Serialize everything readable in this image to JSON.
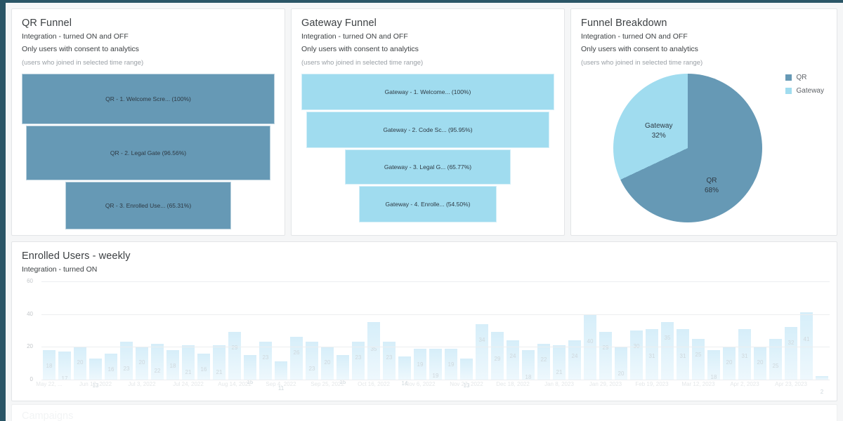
{
  "theme": {
    "qr_color": "#6699b5",
    "gateway_color": "#a0dcef",
    "bar_color": "#d6eef9",
    "page_border": "#2a5566"
  },
  "panels": {
    "qr_funnel": {
      "title": "QR Funnel",
      "subtitle_1": "Integration - turned ON and OFF",
      "subtitle_2": "Only users with consent to analytics",
      "note": "(users who joined in selected time range)"
    },
    "gateway_funnel": {
      "title": "Gateway Funnel",
      "subtitle_1": "Integration - turned ON and OFF",
      "subtitle_2": "Only users with consent to analytics",
      "note": "(users who joined in selected time range)"
    },
    "funnel_breakdown": {
      "title": "Funnel Breakdown",
      "subtitle_1": "Integration - turned ON and OFF",
      "subtitle_2": "Only users with consent to analytics",
      "note": "(users who joined in selected time range)"
    },
    "enrolled_users": {
      "title": "Enrolled Users - weekly",
      "subtitle_1": "Integration - turned ON"
    },
    "campaigns": {
      "title": "Campaigns"
    }
  },
  "chart_data": [
    {
      "type": "bar",
      "title": "QR Funnel",
      "orientation": "funnel",
      "categories": [
        "QR - 1. Welcome Scre...",
        "QR - 2. Legal Gate",
        "QR - 3. Enrolled Use..."
      ],
      "labels": [
        "QR - 1. Welcome Scre... (100%)",
        "QR - 2. Legal Gate (96.56%)",
        "QR - 3. Enrolled Use... (65.31%)"
      ],
      "values": [
        100,
        96.56,
        65.31
      ],
      "ylabel": "",
      "xlabel": "",
      "color": "#6699b5"
    },
    {
      "type": "bar",
      "title": "Gateway Funnel",
      "orientation": "funnel",
      "categories": [
        "Gateway - 1. Welcome...",
        "Gateway - 2. Code Sc...",
        "Gateway - 3. Legal G...",
        "Gateway - 4. Enrolle..."
      ],
      "labels": [
        "Gateway - 1. Welcome... (100%)",
        "Gateway - 2. Code Sc... (95.95%)",
        "Gateway - 3. Legal G... (65.77%)",
        "Gateway - 4. Enrolle... (54.50%)"
      ],
      "values": [
        100,
        95.95,
        65.77,
        54.5
      ],
      "ylabel": "",
      "xlabel": "",
      "color": "#a0dcef"
    },
    {
      "type": "pie",
      "title": "Funnel Breakdown",
      "categories": [
        "QR",
        "Gateway"
      ],
      "values": [
        68,
        32
      ],
      "slice_labels": [
        "QR\n68%",
        "Gateway\n32%"
      ],
      "colors": [
        "#6699b5",
        "#a0dcef"
      ],
      "legend": [
        "QR",
        "Gateway"
      ],
      "legend_position": "right"
    },
    {
      "type": "bar",
      "title": "Enrolled Users - weekly",
      "xlabel": "",
      "ylabel": "",
      "ylim": [
        0,
        60
      ],
      "yticks": [
        0,
        20,
        40,
        60
      ],
      "grid": true,
      "values": [
        18,
        17,
        20,
        13,
        16,
        23,
        20,
        22,
        18,
        21,
        16,
        21,
        29,
        15,
        23,
        11,
        26,
        23,
        20,
        15,
        23,
        35,
        23,
        14,
        19,
        19,
        19,
        13,
        34,
        29,
        24,
        18,
        22,
        21,
        24,
        40,
        29,
        20,
        30,
        31,
        35,
        31,
        25,
        18,
        20,
        31,
        20,
        25,
        32,
        41,
        2
      ],
      "xtick_labels": [
        "May 22, ...",
        "Jun 12, 2022",
        "Jul 3, 2022",
        "Jul 24, 2022",
        "Aug 14, 2022",
        "Sep 4, 2022",
        "Sep 25, 2022",
        "Oct 16, 2022",
        "Nov 6, 2022",
        "Nov 27, 2022",
        "Dec 18, 2022",
        "Jan 8, 2023",
        "Jan 29, 2023",
        "Feb 19, 2023",
        "Mar 12, 2023",
        "Apr 2, 2023",
        "Apr 23, 2023"
      ],
      "xtick_indices": [
        0,
        3,
        6,
        9,
        12,
        15,
        18,
        21,
        24,
        27,
        30,
        33,
        36,
        39,
        42,
        45,
        48
      ]
    }
  ]
}
